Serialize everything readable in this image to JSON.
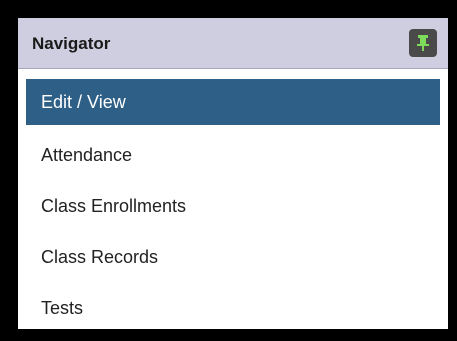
{
  "navigator": {
    "title": "Navigator",
    "pin_icon": "pin-icon",
    "colors": {
      "header_bg": "#cfcee0",
      "pin_bg": "#4a4a4a",
      "pin_icon": "#7ddc5a",
      "selected_bg": "#2e5f86",
      "selected_text": "#ffffff"
    },
    "items": [
      {
        "label": "Edit / View",
        "selected": true
      },
      {
        "label": "Attendance",
        "selected": false
      },
      {
        "label": "Class Enrollments",
        "selected": false
      },
      {
        "label": "Class Records",
        "selected": false
      },
      {
        "label": "Tests",
        "selected": false
      }
    ]
  }
}
